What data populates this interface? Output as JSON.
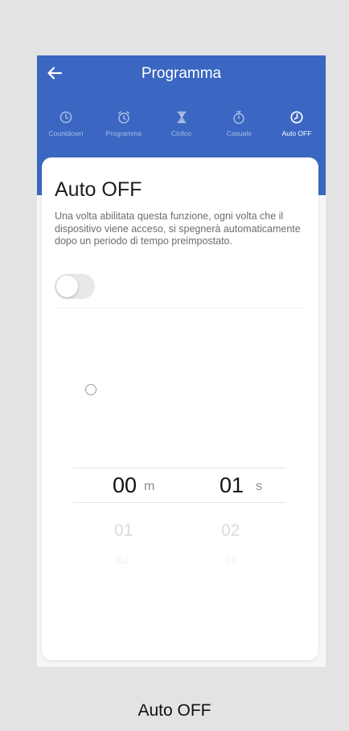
{
  "header": {
    "title": "Programma",
    "back_icon": "arrow-left-icon",
    "color": "#3b67c2"
  },
  "tabs": [
    {
      "label": "Countdown",
      "icon": "clock-icon",
      "active": false
    },
    {
      "label": "Programma",
      "icon": "alarm-icon",
      "active": false
    },
    {
      "label": "Ciclico",
      "icon": "hourglass-icon",
      "active": false
    },
    {
      "label": "Casuale",
      "icon": "stopwatch-icon",
      "active": false
    },
    {
      "label": "Auto OFF",
      "icon": "clock-filled-icon",
      "active": true
    }
  ],
  "card": {
    "title": "Auto OFF",
    "description": "Una volta abilitata questa funzione, ogni volta che il dispositivo viene acceso, si spegnerà automaticamente dopo un periodo di tempo preimpostato.",
    "toggle_on": false
  },
  "picker": {
    "minutes": {
      "selected": "00",
      "unit": "m",
      "next": "01",
      "next2": "02"
    },
    "seconds": {
      "selected": "01",
      "unit": "s",
      "next": "02",
      "next2": "03"
    }
  },
  "caption": "Auto OFF"
}
